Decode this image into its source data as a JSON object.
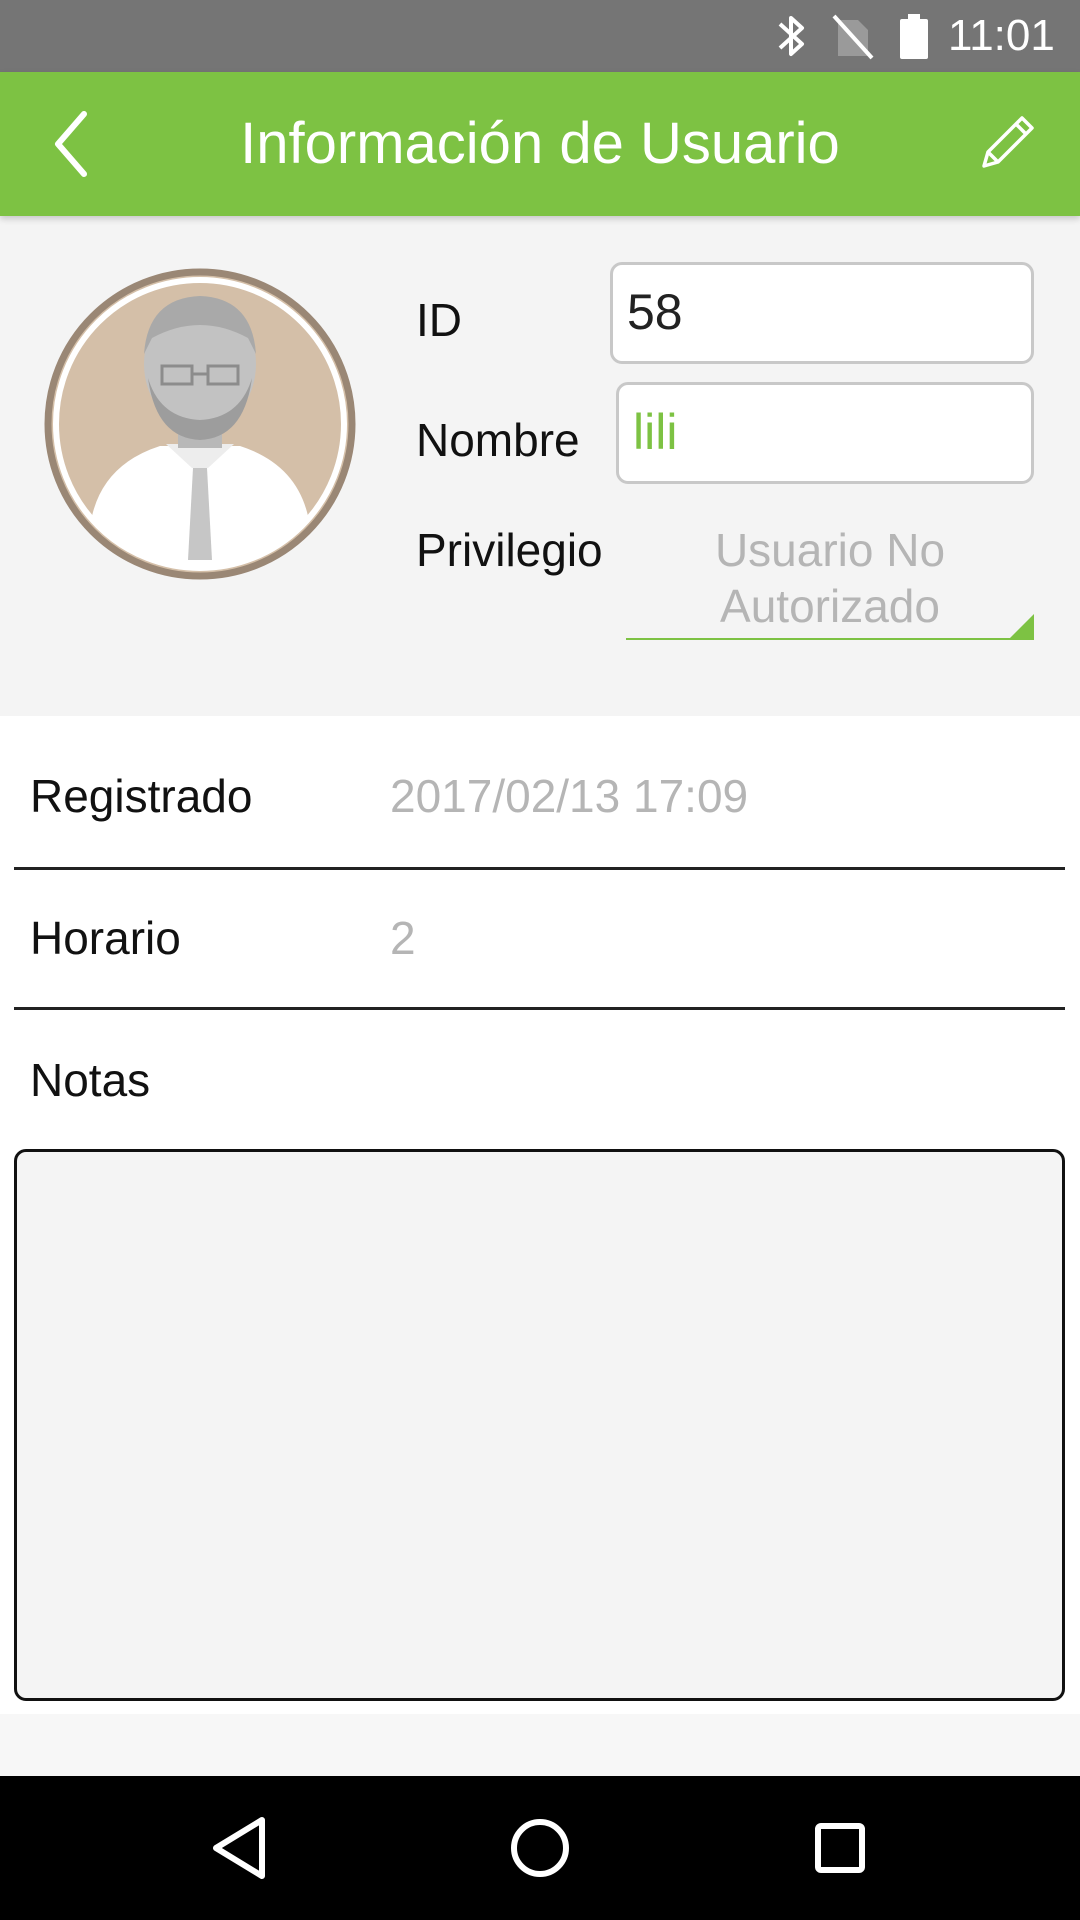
{
  "status_bar": {
    "time": "11:01",
    "icons": [
      "bluetooth-icon",
      "no-sim-icon",
      "battery-icon"
    ]
  },
  "app_bar": {
    "title": "Información de Usuario",
    "back_icon": "chevron-left-icon",
    "edit_icon": "pencil-icon",
    "background_color": "#7dc243"
  },
  "profile": {
    "avatar_icon": "user-avatar-icon",
    "id_label": "ID",
    "id_value": "58",
    "name_label": "Nombre",
    "name_value": "lili",
    "privilege_label": "Privilegio",
    "privilege_value_line1": "Usuario No",
    "privilege_value_line2": "Autorizado"
  },
  "details": {
    "registered_label": "Registrado",
    "registered_value": "2017/02/13 17:09",
    "schedule_label": "Horario",
    "schedule_value": "2",
    "notes_label": "Notas",
    "notes_value": ""
  },
  "nav_bar": {
    "icons": [
      "back-triangle-icon",
      "home-circle-icon",
      "recent-apps-icon"
    ]
  },
  "colors": {
    "accent": "#7dc243",
    "muted_text": "#b5b5b5",
    "section_bg": "#f4f4f4"
  }
}
